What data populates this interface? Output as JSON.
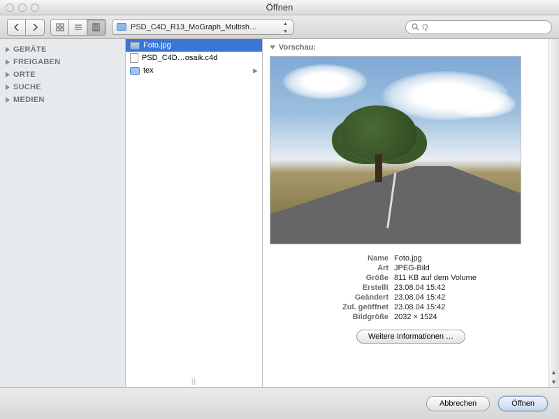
{
  "window": {
    "title": "Öffnen"
  },
  "toolbar": {
    "path_label": "PSD_C4D_R13_MoGraph_Multish…",
    "search_placeholder": "Q"
  },
  "sidebar": {
    "sections": [
      {
        "label": "GERÄTE"
      },
      {
        "label": "FREIGABEN"
      },
      {
        "label": "ORTE"
      },
      {
        "label": "SUCHE"
      },
      {
        "label": "MEDIEN"
      }
    ]
  },
  "files": [
    {
      "name": "Foto.jpg",
      "kind": "image",
      "selected": true
    },
    {
      "name": "PSD_C4D…osaik.c4d",
      "kind": "doc",
      "selected": false
    },
    {
      "name": "tex",
      "kind": "folder",
      "selected": false
    }
  ],
  "preview": {
    "heading": "Vorschau:",
    "meta_labels": {
      "name": "Name",
      "art": "Art",
      "groesse": "Größe",
      "erstellt": "Erstellt",
      "geaendert": "Geändert",
      "geoeffnet": "Zul. geöffnet",
      "bildgroesse": "Bildgröße"
    },
    "meta_values": {
      "name": "Foto.jpg",
      "art": "JPEG-Bild",
      "groesse": "811 KB auf dem Volume",
      "erstellt": "23.08.04 15:42",
      "geaendert": "23.08.04 15:42",
      "geoeffnet": "23.08.04 15:42",
      "bildgroesse": "2032 × 1524"
    },
    "more_info_label": "Weitere Informationen …"
  },
  "footer": {
    "cancel": "Abbrechen",
    "open": "Öffnen"
  }
}
